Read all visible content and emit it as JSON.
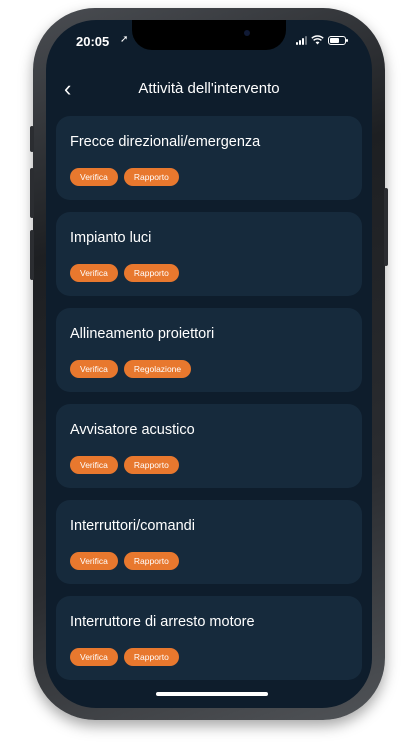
{
  "status": {
    "time": "20:05",
    "location_icon": "location-arrow-icon",
    "signal_icon": "cellular-signal-icon",
    "wifi_icon": "wifi-icon",
    "battery_icon": "battery-icon"
  },
  "header": {
    "back_icon": "chevron-left-icon",
    "title": "Attività dell'intervento"
  },
  "colors": {
    "background": "#0e1d2c",
    "card": "#162a3c",
    "tag": "#e8782e"
  },
  "activities": [
    {
      "title": "Frecce direzionali/emergenza",
      "tags": [
        "Verifica",
        "Rapporto"
      ]
    },
    {
      "title": "Impianto luci",
      "tags": [
        "Verifica",
        "Rapporto"
      ]
    },
    {
      "title": "Allineamento proiettori",
      "tags": [
        "Verifica",
        "Regolazione"
      ]
    },
    {
      "title": "Avvisatore acustico",
      "tags": [
        "Verifica",
        "Rapporto"
      ]
    },
    {
      "title": "Interruttori/comandi",
      "tags": [
        "Verifica",
        "Rapporto"
      ]
    },
    {
      "title": "Interruttore di arresto motore",
      "tags": [
        "Verifica",
        "Rapporto"
      ]
    }
  ]
}
